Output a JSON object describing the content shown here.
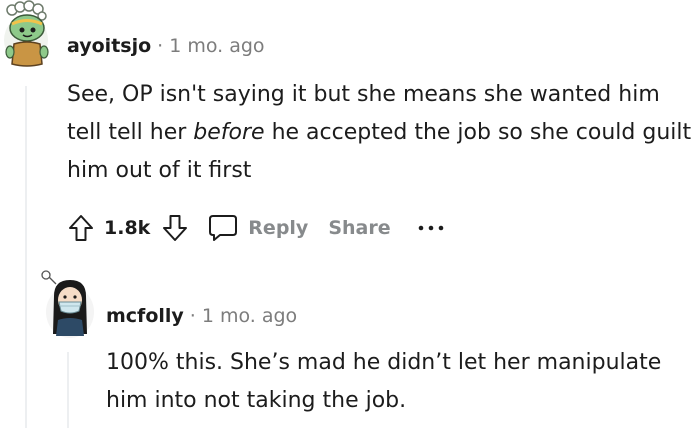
{
  "comments": [
    {
      "username": "ayoitsjo",
      "separator": "·",
      "timestamp": "1 mo. ago",
      "body_before": "See, OP isn't saying it but she means she wanted him tell tell her ",
      "body_emphasis": "before",
      "body_after": " he accepted the job so she could guilt him out of it first",
      "vote_count": "1.8k",
      "reply_label": "Reply",
      "share_label": "Share"
    },
    {
      "username": "mcfolly",
      "separator": "·",
      "timestamp": "1 mo. ago",
      "body": "100% this. She’s mad he didn’t let her manipulate him into not taking the job."
    }
  ],
  "icons": {
    "upvote": "arrow-up-outline",
    "downvote": "arrow-down-outline",
    "reply": "speech-bubble-outline",
    "more": "horizontal-ellipsis"
  },
  "colors": {
    "text": "#1c1c1c",
    "muted": "#7c7c7c",
    "action_muted": "#878a8c",
    "thread_line": "#edeff1"
  }
}
